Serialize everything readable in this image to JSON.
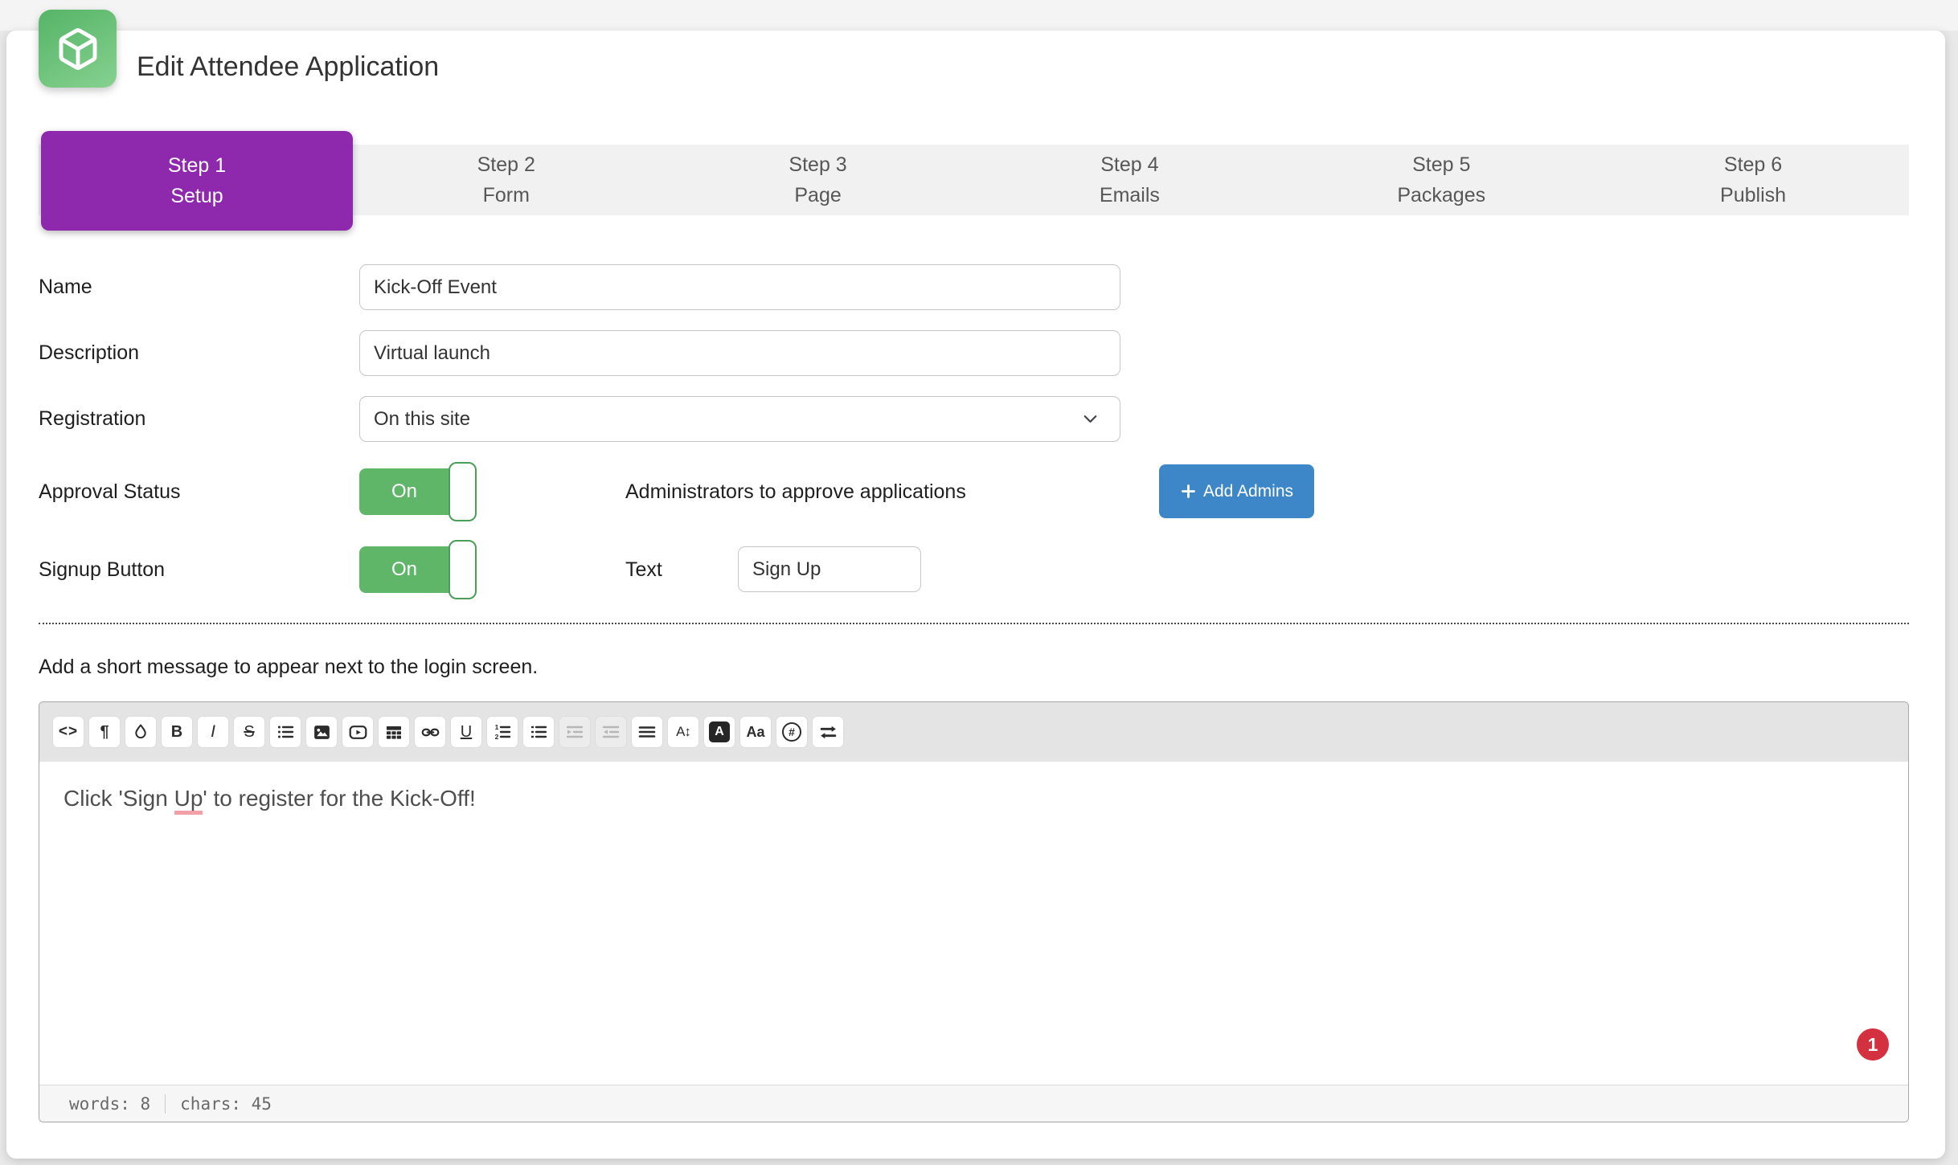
{
  "header": {
    "title": "Edit Attendee Application",
    "logo": "green-box"
  },
  "steps": [
    {
      "num": "Step 1",
      "label": "Setup",
      "active": true
    },
    {
      "num": "Step 2",
      "label": "Form"
    },
    {
      "num": "Step 3",
      "label": "Page"
    },
    {
      "num": "Step 4",
      "label": "Emails"
    },
    {
      "num": "Step 5",
      "label": "Packages"
    },
    {
      "num": "Step 6",
      "label": "Publish"
    }
  ],
  "form": {
    "name": {
      "label": "Name",
      "value": "Kick-Off Event"
    },
    "description": {
      "label": "Description",
      "value": "Virtual launch"
    },
    "registration": {
      "label": "Registration",
      "value": "On this site"
    },
    "approval": {
      "label": "Approval Status",
      "toggle": "On",
      "admins_label": "Administrators to approve applications",
      "add_admins_label": "Add Admins"
    },
    "signup": {
      "label": "Signup Button",
      "toggle": "On",
      "text_label": "Text",
      "text_value": "Sign Up"
    }
  },
  "hint": "Add a short message to appear next to the login screen.",
  "editor": {
    "toolbar": [
      {
        "name": "view-html",
        "glyph": "<>"
      },
      {
        "name": "paragraph-format",
        "glyph": "¶"
      },
      {
        "name": "text-color"
      },
      {
        "name": "bold",
        "glyph": "B"
      },
      {
        "name": "italic",
        "glyph": "I"
      },
      {
        "name": "strikethrough",
        "glyph": "S"
      },
      {
        "name": "unordered-list"
      },
      {
        "name": "insert-image"
      },
      {
        "name": "insert-video"
      },
      {
        "name": "insert-table"
      },
      {
        "name": "link"
      },
      {
        "name": "underline",
        "glyph": "U"
      },
      {
        "name": "ordered-list"
      },
      {
        "name": "bullet-list"
      },
      {
        "name": "indent",
        "disabled": true
      },
      {
        "name": "outdent",
        "disabled": true
      },
      {
        "name": "align-justify"
      },
      {
        "name": "font-size",
        "glyph": "A↕"
      },
      {
        "name": "text-background",
        "glyph": "A"
      },
      {
        "name": "text-case",
        "glyph": "Aa"
      },
      {
        "name": "special-character",
        "glyph": "#"
      },
      {
        "name": "text-direction"
      }
    ],
    "content": {
      "before": "Click 'Sign ",
      "marked": "Up",
      "after": "' to register for the Kick-Off!"
    },
    "badge": "1",
    "footer": {
      "words": "words: 8",
      "chars": "chars: 45"
    }
  },
  "colors": {
    "accent_purple": "#8e28ad",
    "toggle_green": "#5fb669",
    "button_blue": "#3d87c8",
    "badge_red": "#d3313f",
    "mark_pink": "#f2a0a6",
    "logo_green": "#6cc27b"
  }
}
